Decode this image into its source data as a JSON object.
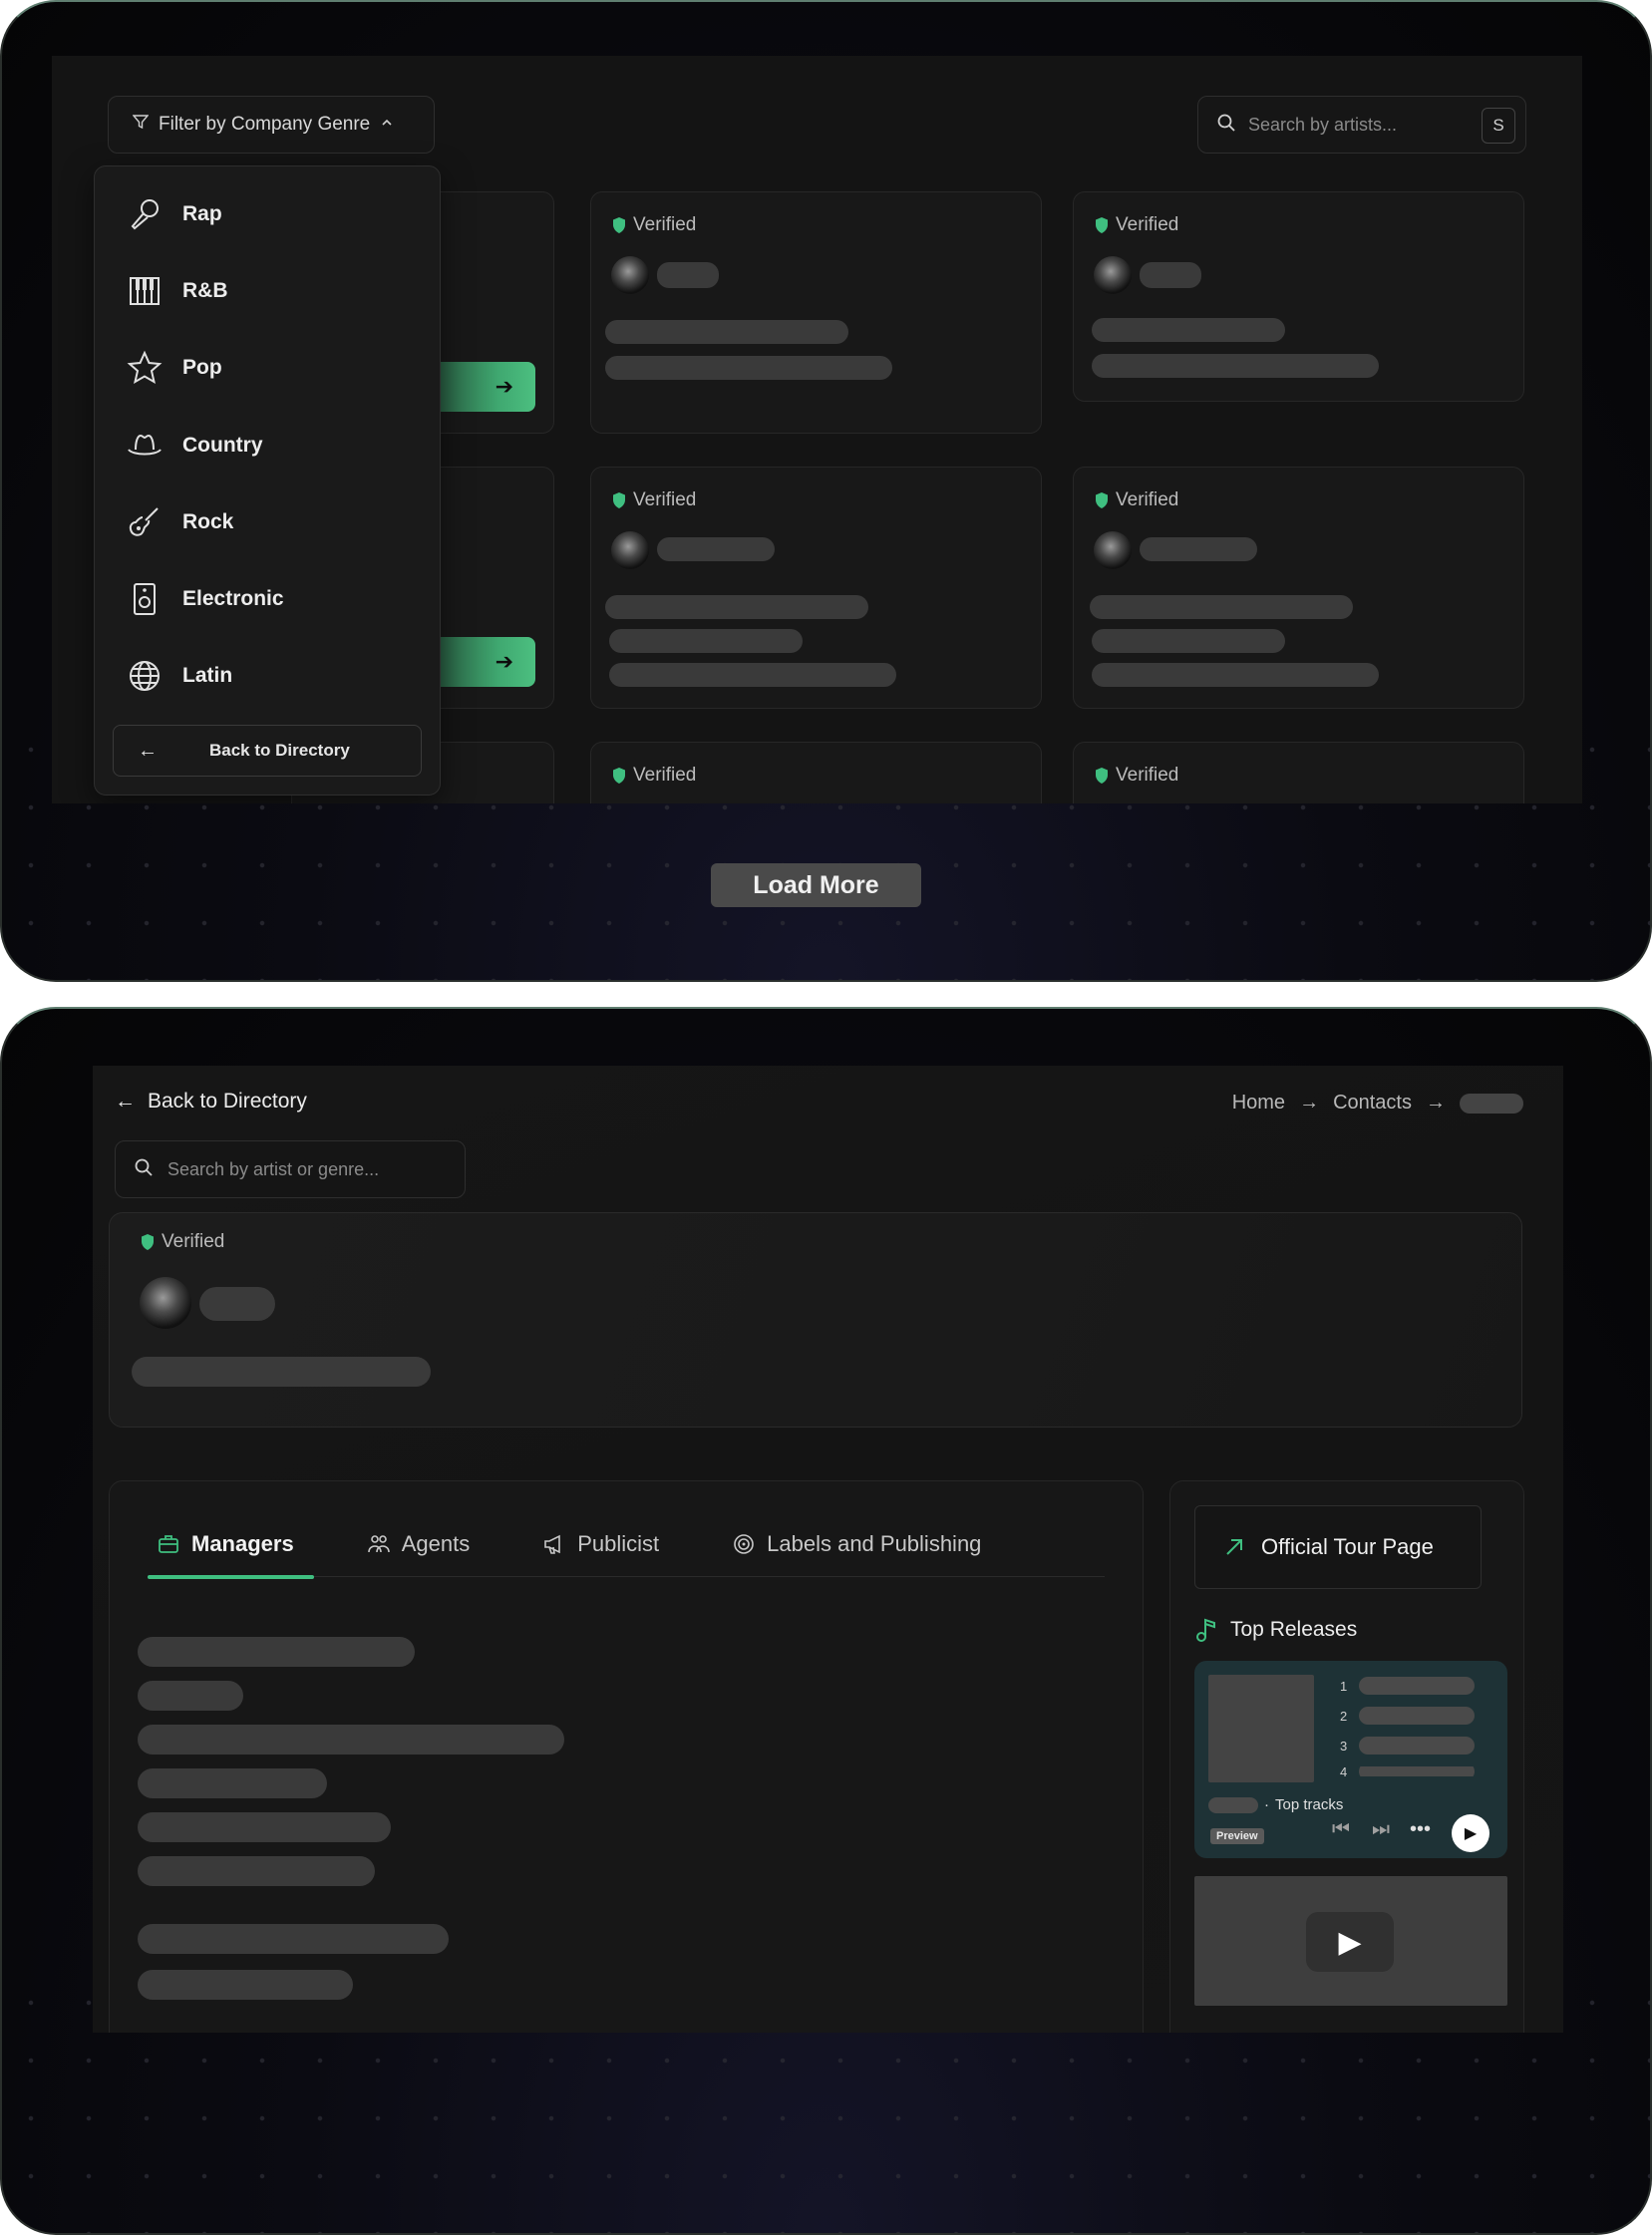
{
  "directory": {
    "filter_label": "Filter by Company Genre",
    "search_placeholder": "Search by artists...",
    "search_shortcut": "S",
    "genres": [
      {
        "label": "Rap",
        "icon": "microphone-icon"
      },
      {
        "label": "R&B",
        "icon": "piano-icon"
      },
      {
        "label": "Pop",
        "icon": "star-icon"
      },
      {
        "label": "Country",
        "icon": "cowboy-hat-icon"
      },
      {
        "label": "Rock",
        "icon": "guitar-icon"
      },
      {
        "label": "Electronic",
        "icon": "speaker-icon"
      },
      {
        "label": "Latin",
        "icon": "globe-icon"
      }
    ],
    "back_to_directory": "Back to Directory",
    "verified_label": "Verified",
    "load_more": "Load More"
  },
  "profile_page": {
    "back_link": "Back to Directory",
    "breadcrumb": [
      "Home",
      "Contacts"
    ],
    "search_placeholder": "Search by artist or genre...",
    "verified_label": "Verified",
    "tabs": [
      {
        "label": "Managers",
        "icon": "briefcase-icon",
        "active": true
      },
      {
        "label": "Agents",
        "icon": "people-icon",
        "active": false
      },
      {
        "label": "Publicist",
        "icon": "megaphone-icon",
        "active": false
      },
      {
        "label": "Labels and Publishing",
        "icon": "vinyl-icon",
        "active": false
      }
    ],
    "official_tour_page": "Official Tour Page",
    "top_releases": "Top Releases",
    "player": {
      "track_numbers": [
        "1",
        "2",
        "3",
        "4"
      ],
      "top_tracks": "Top tracks",
      "preview": "Preview"
    }
  },
  "colors": {
    "accent": "#3fbf80",
    "background": "#141414",
    "skeleton": "#3a3a3a"
  }
}
